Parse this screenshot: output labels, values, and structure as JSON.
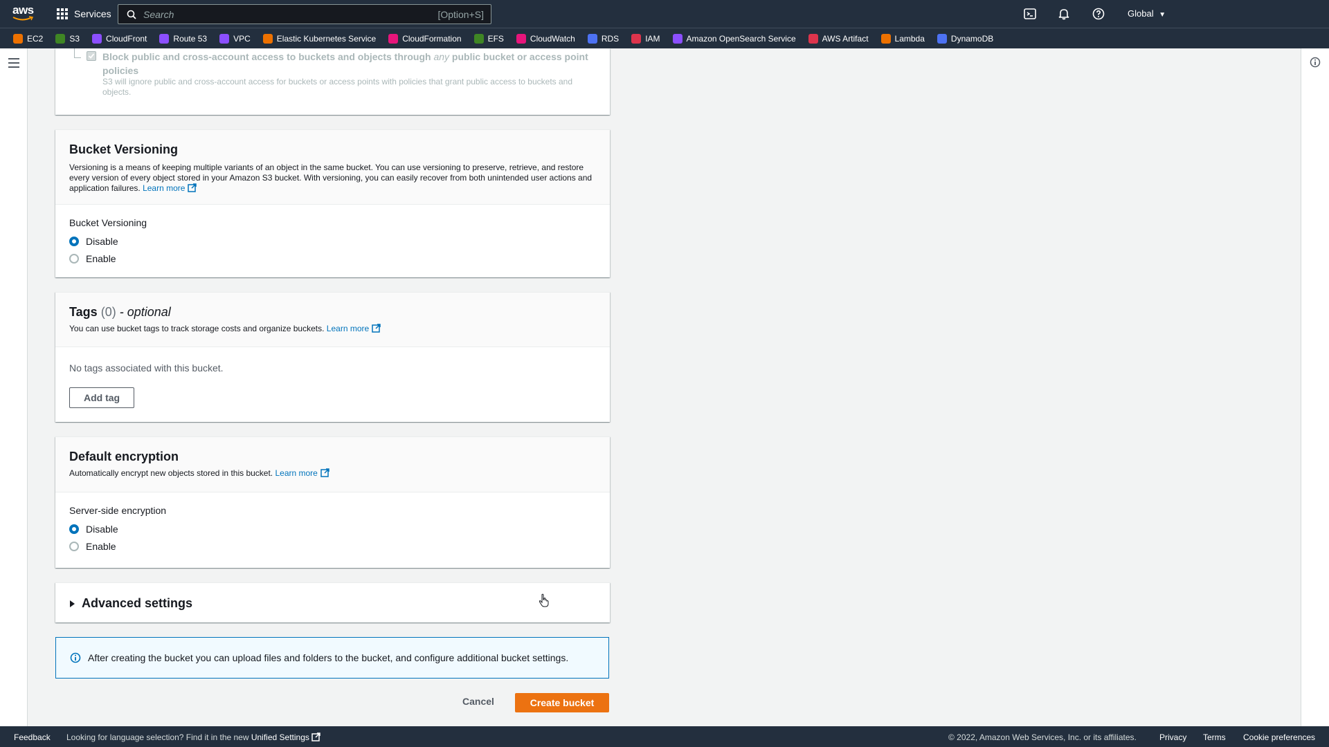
{
  "topnav": {
    "logo_text": "aws",
    "services_label": "Services",
    "search_placeholder": "Search",
    "search_shortcut": "[Option+S]",
    "region_label": "Global"
  },
  "favorites": [
    {
      "label": "EC2",
      "color": "#ed7100"
    },
    {
      "label": "S3",
      "color": "#3f8624"
    },
    {
      "label": "CloudFront",
      "color": "#8c4fff"
    },
    {
      "label": "Route 53",
      "color": "#8c4fff"
    },
    {
      "label": "VPC",
      "color": "#8c4fff"
    },
    {
      "label": "Elastic Kubernetes Service",
      "color": "#ed7100"
    },
    {
      "label": "CloudFormation",
      "color": "#e7157b"
    },
    {
      "label": "EFS",
      "color": "#3f8624"
    },
    {
      "label": "CloudWatch",
      "color": "#e7157b"
    },
    {
      "label": "RDS",
      "color": "#4d72f3"
    },
    {
      "label": "IAM",
      "color": "#dd344c"
    },
    {
      "label": "Amazon OpenSearch Service",
      "color": "#8c4fff"
    },
    {
      "label": "AWS Artifact",
      "color": "#dd344c"
    },
    {
      "label": "Lambda",
      "color": "#ed7100"
    },
    {
      "label": "DynamoDB",
      "color": "#4d72f3"
    }
  ],
  "block_access": {
    "label_before": "Block public and cross-account access to buckets and objects through ",
    "label_italic": "any",
    "label_after": " public bucket or access point policies",
    "description": "S3 will ignore public and cross-account access for buckets or access points with policies that grant public access to buckets and objects."
  },
  "versioning": {
    "title": "Bucket Versioning",
    "description": "Versioning is a means of keeping multiple variants of an object in the same bucket. You can use versioning to preserve, retrieve, and restore every version of every object stored in your Amazon S3 bucket. With versioning, you can easily recover from both unintended user actions and application failures.",
    "learn_more": "Learn more",
    "field_label": "Bucket Versioning",
    "options": [
      "Disable",
      "Enable"
    ],
    "selected": "Disable"
  },
  "tags": {
    "title": "Tags",
    "count": "(0)",
    "optional": "- optional",
    "description": "You can use bucket tags to track storage costs and organize buckets.",
    "learn_more": "Learn more",
    "empty_text": "No tags associated with this bucket.",
    "add_button": "Add tag"
  },
  "encryption": {
    "title": "Default encryption",
    "description": "Automatically encrypt new objects stored in this bucket.",
    "learn_more": "Learn more",
    "field_label": "Server-side encryption",
    "options": [
      "Disable",
      "Enable"
    ],
    "selected": "Disable"
  },
  "advanced": {
    "title": "Advanced settings"
  },
  "info_alert": {
    "text": "After creating the bucket you can upload files and folders to the bucket, and configure additional bucket settings."
  },
  "actions": {
    "cancel": "Cancel",
    "create": "Create bucket"
  },
  "footer": {
    "feedback": "Feedback",
    "lang_text": "Looking for language selection? Find it in the new ",
    "unified_settings": "Unified Settings",
    "copyright": "© 2022, Amazon Web Services, Inc. or its affiliates.",
    "privacy": "Privacy",
    "terms": "Terms",
    "cookies": "Cookie preferences"
  },
  "colors": {
    "nav_bg": "#232f3e",
    "primary_button": "#ec7211",
    "link": "#0073bb",
    "info_bg": "#f1faff"
  }
}
